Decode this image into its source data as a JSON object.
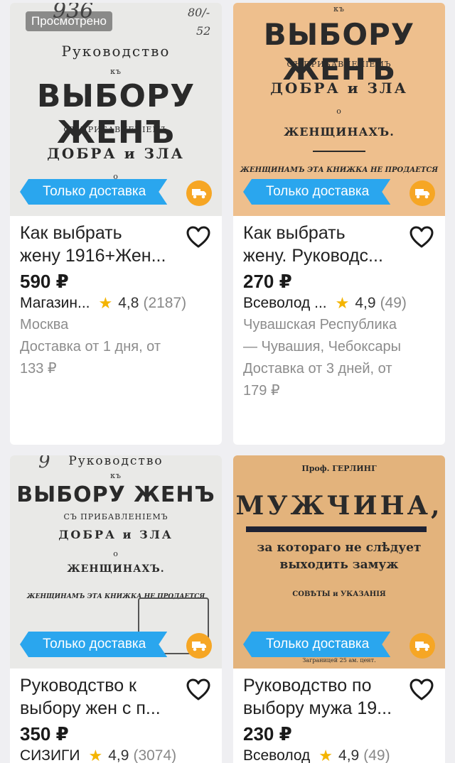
{
  "badges": {
    "viewed": "Просмотрено",
    "delivery_only": "Только доставка"
  },
  "covers": {
    "book1": {
      "top": "Руководство",
      "kъ": "къ",
      "big": "ВЫБОРУ ЖЕНЪ",
      "sub": "СЪ ПРИБАВЛЕНІЕМЪ",
      "mid": "ДОБРА и ЗЛА",
      "o": "о",
      "num1": "80/-",
      "num2": "52"
    },
    "book2": {
      "kъ": "къ",
      "big": "ВЫБОРУ ЖЕНЪ",
      "sub": "СЪ ПРИБАВЛЕНІЕМЪ",
      "mid": "ДОБРА и ЗЛА",
      "o": "о",
      "women": "ЖЕНЩИНАХЪ.",
      "notice": "ЖЕНЩИНАМЪ ЭТА КНИЖКА НЕ ПРОДАЕТСЯ"
    },
    "book3": {
      "top": "Руководство",
      "kъ": "къ",
      "big": "ВЫБОРУ ЖЕНЪ",
      "sub": "СЪ ПРИБАВЛЕНІЕМЪ",
      "mid": "ДОБРА и ЗЛА",
      "o": "о",
      "women": "ЖЕНЩИНАХЪ.",
      "notice": "ЖЕНЩИНАМЪ ЭТА КНИЖКА НЕ ПРОДАЕТСЯ"
    },
    "book4": {
      "author": "Проф. ГЕРЛИНГ",
      "big": "МУЖЧИНА,",
      "line1": "за котораго не слѣдует",
      "line2": "выходить замуж",
      "small": "СОВѢТЫ и УКАЗАНІЯ",
      "foot": "Заграницей 25 ам. цент."
    }
  },
  "products": [
    {
      "title_line1": "Как выбрать",
      "title_line2": "жену 1916+Жен...",
      "price": "590 ₽",
      "seller": "Магазин...",
      "rating": "4,8",
      "reviews": "(2187)",
      "location": "Москва",
      "delivery_line1": "Доставка от 1 дня, от",
      "delivery_line2": "133 ₽"
    },
    {
      "title_line1": "Как выбрать",
      "title_line2": "жену. Руководс...",
      "price": "270 ₽",
      "seller": "Всеволод ...",
      "rating": "4,9",
      "reviews": "(49)",
      "location_line1": "Чувашская Республика",
      "location_line2": "— Чувашия, Чебоксары",
      "delivery_line1": "Доставка от 3 дней, от",
      "delivery_line2": "179 ₽"
    },
    {
      "title_line1": "Руководство к",
      "title_line2": "выбору жен с п...",
      "price": "350 ₽",
      "seller": "СИЗИГИ",
      "rating": "4,9",
      "reviews": "(3074)"
    },
    {
      "title_line1": "Руководство по",
      "title_line2": "выбору мужа 19...",
      "price": "230 ₽",
      "seller": "Всеволод",
      "rating": "4,9",
      "reviews": "(49)"
    }
  ],
  "colors": {
    "accent_blue": "#2aa6ee",
    "truck_orange": "#f6a624",
    "star": "#f4b400"
  },
  "icons": {
    "favorite": "heart-icon",
    "delivery": "truck-icon",
    "rating": "star-icon"
  }
}
